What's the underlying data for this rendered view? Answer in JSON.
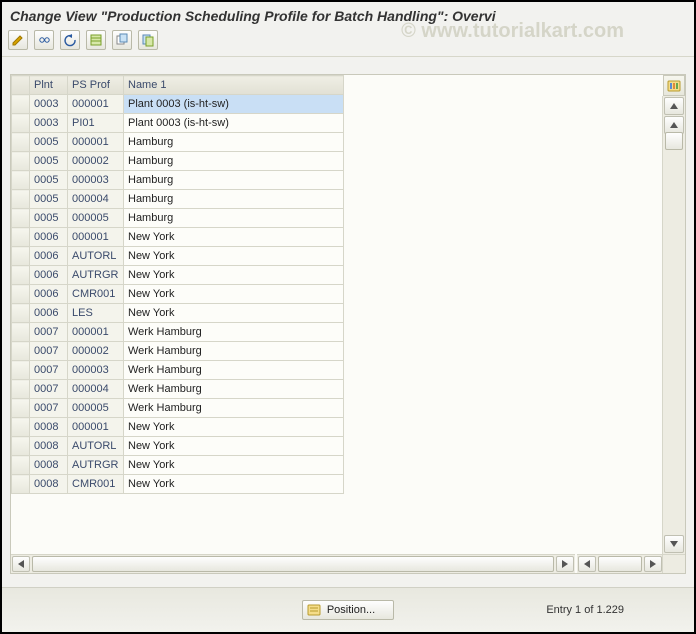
{
  "window": {
    "title": "Change View \"Production Scheduling Profile for Batch Handling\": Overvi",
    "watermark": "© www.tutorialkart.com"
  },
  "toolbar": {
    "icons": [
      "edit",
      "glasses",
      "undo",
      "new-entries",
      "copy",
      "delete"
    ]
  },
  "grid": {
    "columns": {
      "sel": "",
      "plnt": "Plnt",
      "psprof": "PS Prof",
      "name": "Name 1"
    },
    "rows": [
      {
        "plnt": "0003",
        "psprof": "000001",
        "name": "Plant 0003 (is-ht-sw)",
        "selected": true
      },
      {
        "plnt": "0003",
        "psprof": "PI01",
        "name": "Plant 0003 (is-ht-sw)"
      },
      {
        "plnt": "0005",
        "psprof": "000001",
        "name": "Hamburg"
      },
      {
        "plnt": "0005",
        "psprof": "000002",
        "name": "Hamburg"
      },
      {
        "plnt": "0005",
        "psprof": "000003",
        "name": "Hamburg"
      },
      {
        "plnt": "0005",
        "psprof": "000004",
        "name": "Hamburg"
      },
      {
        "plnt": "0005",
        "psprof": "000005",
        "name": "Hamburg"
      },
      {
        "plnt": "0006",
        "psprof": "000001",
        "name": "New York"
      },
      {
        "plnt": "0006",
        "psprof": "AUTORL",
        "name": "New York"
      },
      {
        "plnt": "0006",
        "psprof": "AUTRGR",
        "name": "New York"
      },
      {
        "plnt": "0006",
        "psprof": "CMR001",
        "name": "New York"
      },
      {
        "plnt": "0006",
        "psprof": "LES",
        "name": "New York"
      },
      {
        "plnt": "0007",
        "psprof": "000001",
        "name": "Werk Hamburg"
      },
      {
        "plnt": "0007",
        "psprof": "000002",
        "name": "Werk Hamburg"
      },
      {
        "plnt": "0007",
        "psprof": "000003",
        "name": "Werk Hamburg"
      },
      {
        "plnt": "0007",
        "psprof": "000004",
        "name": "Werk Hamburg"
      },
      {
        "plnt": "0007",
        "psprof": "000005",
        "name": "Werk Hamburg"
      },
      {
        "plnt": "0008",
        "psprof": "000001",
        "name": "New York"
      },
      {
        "plnt": "0008",
        "psprof": "AUTORL",
        "name": "New York"
      },
      {
        "plnt": "0008",
        "psprof": "AUTRGR",
        "name": "New York"
      },
      {
        "plnt": "0008",
        "psprof": "CMR001",
        "name": "New York"
      }
    ]
  },
  "status": {
    "position_label": "Position...",
    "entry_label": "Entry 1 of 1.229"
  }
}
